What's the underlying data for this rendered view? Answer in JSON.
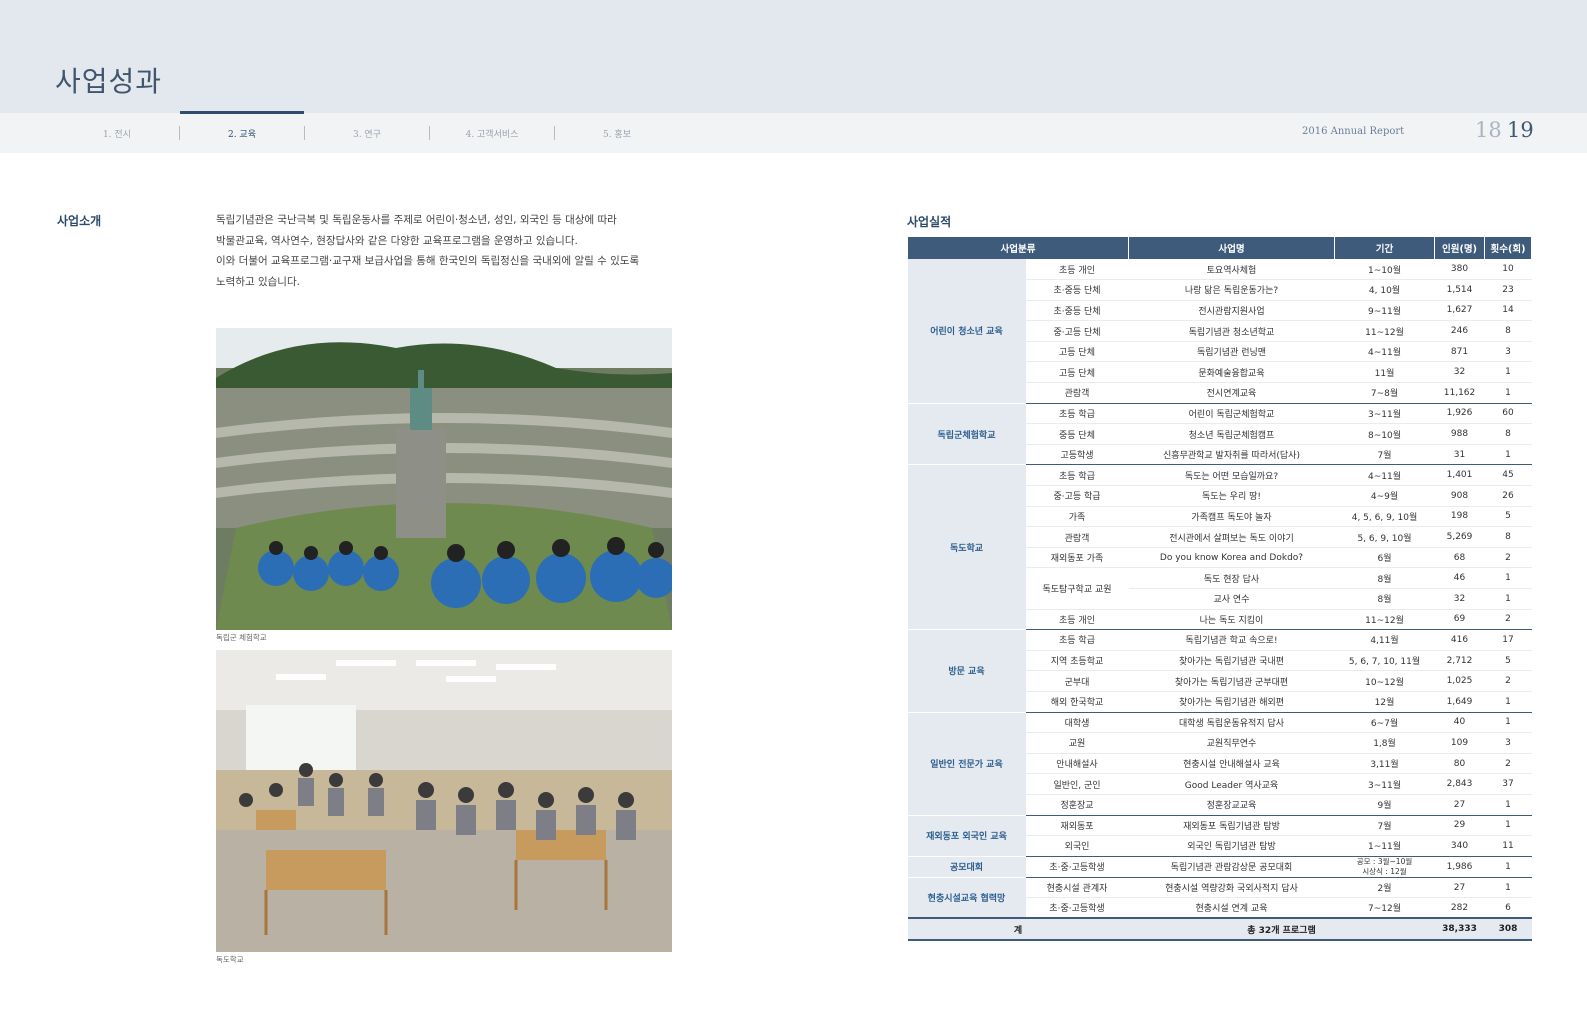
{
  "header": {
    "title": "사업성과",
    "tabs": [
      {
        "label": "1. 전시"
      },
      {
        "label": "2. 교육"
      },
      {
        "label": "3. 연구"
      },
      {
        "label": "4. 고객서비스"
      },
      {
        "label": "5. 홍보"
      }
    ],
    "report_label": "2016 Annual Report",
    "page_left": "18",
    "page_right": "19"
  },
  "intro": {
    "heading": "사업소개",
    "lines": [
      "독립기념관은 국난극복 및 독립운동사를 주제로 어린이·청소년, 성인, 외국인 등 대상에 따라",
      "박물관교육, 역사연수, 현장답사와 같은 다양한 교육프로그램을 운영하고 있습니다.",
      "이와 더불어 교육프로그램·교구재 보급사업을 통해 한국인의 독립정신을 국내외에 알릴 수 있도록",
      "노력하고 있습니다."
    ]
  },
  "photos": [
    {
      "caption": "독립군 체험학교"
    },
    {
      "caption": "독도학교"
    }
  ],
  "performance": {
    "heading": "사업실적",
    "columns": [
      "사업분류",
      "사업명",
      "기간",
      "인원(명)",
      "횟수(회)"
    ],
    "categories": [
      "어린이 청소년 교육",
      "독립군체험학교",
      "독도학교",
      "방문 교육",
      "일반인 전문가 교육",
      "재외동포 외국인 교육",
      "공모대회",
      "현충시설교육 협력망"
    ],
    "rows": [
      {
        "target": "초등 개인",
        "name": "토요역사체험",
        "period": "1~10월",
        "people": "380",
        "count": "10"
      },
      {
        "target": "초·중등 단체",
        "name": "나랑 닮은 독립운동가는?",
        "period": "4, 10월",
        "people": "1,514",
        "count": "23"
      },
      {
        "target": "초·중등 단체",
        "name": "전시관람지원사업",
        "period": "9~11월",
        "people": "1,627",
        "count": "14"
      },
      {
        "target": "중·고등 단체",
        "name": "독립기념관 청소년학교",
        "period": "11~12월",
        "people": "246",
        "count": "8"
      },
      {
        "target": "고등 단체",
        "name": "독립기념관 런닝맨",
        "period": "4~11월",
        "people": "871",
        "count": "3"
      },
      {
        "target": "고등 단체",
        "name": "문화예술융합교육",
        "period": "11월",
        "people": "32",
        "count": "1"
      },
      {
        "target": "관람객",
        "name": "전시연계교육",
        "period": "7~8월",
        "people": "11,162",
        "count": "1"
      },
      {
        "target": "초등 학급",
        "name": "어린이 독립군체험학교",
        "period": "3~11월",
        "people": "1,926",
        "count": "60"
      },
      {
        "target": "중등 단체",
        "name": "청소년 독립군체험캠프",
        "period": "8~10월",
        "people": "988",
        "count": "8"
      },
      {
        "target": "고등학생",
        "name": "신흥무관학교 발자취를 따라서(답사)",
        "period": "7월",
        "people": "31",
        "count": "1"
      },
      {
        "target": "초등 학급",
        "name": "독도는 어떤 모습일까요?",
        "period": "4~11월",
        "people": "1,401",
        "count": "45"
      },
      {
        "target": "중·고등 학급",
        "name": "독도는 우리 땅!",
        "period": "4~9월",
        "people": "908",
        "count": "26"
      },
      {
        "target": "가족",
        "name": "가족캠프 독도야 놀자",
        "period": "4, 5, 6, 9, 10월",
        "people": "198",
        "count": "5"
      },
      {
        "target": "관람객",
        "name": "전시관에서 살펴보는 독도 이야기",
        "period": "5, 6, 9, 10월",
        "people": "5,269",
        "count": "8"
      },
      {
        "target": "재외동포 가족",
        "name": "Do you know Korea and Dokdo?",
        "period": "6월",
        "people": "68",
        "count": "2"
      },
      {
        "target": "독도탐구학교 교원",
        "name": "독도 현장 답사",
        "period": "8월",
        "people": "46",
        "count": "1"
      },
      {
        "target": "",
        "name": "교사 연수",
        "period": "8월",
        "people": "32",
        "count": "1"
      },
      {
        "target": "초등 개인",
        "name": "나는 독도 지킴이",
        "period": "11~12월",
        "people": "69",
        "count": "2"
      },
      {
        "target": "초등 학급",
        "name": "독립기념관 학교 속으로!",
        "period": "4,11월",
        "people": "416",
        "count": "17"
      },
      {
        "target": "지역 초등학교",
        "name": "찾아가는 독립기념관 국내편",
        "period": "5, 6, 7, 10, 11월",
        "people": "2,712",
        "count": "5"
      },
      {
        "target": "군부대",
        "name": "찾아가는 독립기념관 군부대편",
        "period": "10~12월",
        "people": "1,025",
        "count": "2"
      },
      {
        "target": "해외 한국학교",
        "name": "찾아가는 독립기념관 해외편",
        "period": "12월",
        "people": "1,649",
        "count": "1"
      },
      {
        "target": "대학생",
        "name": "대학생 독립운동유적지 답사",
        "period": "6~7월",
        "people": "40",
        "count": "1"
      },
      {
        "target": "교원",
        "name": "교원직무연수",
        "period": "1,8월",
        "people": "109",
        "count": "3"
      },
      {
        "target": "안내해설사",
        "name": "현충시설 안내해설사 교육",
        "period": "3,11월",
        "people": "80",
        "count": "2"
      },
      {
        "target": "일반인, 군인",
        "name": "Good Leader 역사교육",
        "period": "3~11월",
        "people": "2,843",
        "count": "37"
      },
      {
        "target": "정훈장교",
        "name": "정훈장교교육",
        "period": "9월",
        "people": "27",
        "count": "1"
      },
      {
        "target": "재외동포",
        "name": "재외동포 독립기념관 탐방",
        "period": "7월",
        "people": "29",
        "count": "1"
      },
      {
        "target": "외국인",
        "name": "외국인 독립기념관 탐방",
        "period": "1~11월",
        "people": "340",
        "count": "11"
      },
      {
        "target": "초·중·고등학생",
        "name": "독립기념관 관람감상문 공모대회",
        "period_line1": "공모 : 3월~10월",
        "period_line2": "시상식 : 12월",
        "people": "1,986",
        "count": "1"
      },
      {
        "target": "현충시설 관계자",
        "name": "현충시설 역량강화 국외사적지 답사",
        "period": "2월",
        "people": "27",
        "count": "1"
      },
      {
        "target": "초·중·고등학생",
        "name": "현충시설 연계 교육",
        "period": "7~12월",
        "people": "282",
        "count": "6"
      }
    ],
    "total": {
      "label": "계",
      "name": "총 32개 프로그램",
      "people": "38,333",
      "count": "308"
    }
  }
}
